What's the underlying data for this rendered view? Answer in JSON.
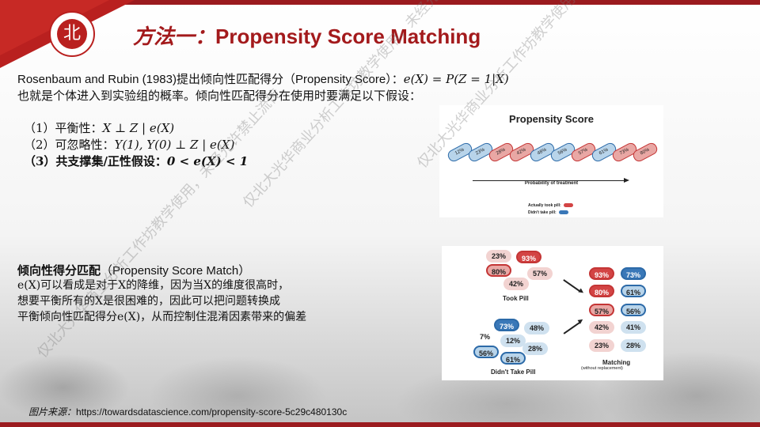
{
  "title": {
    "cn": "方法一：",
    "en": "Propensity Score Matching"
  },
  "logo": {
    "glyph": "北",
    "icon": "pku-logo-icon"
  },
  "intro": {
    "line1_a": "Rosenbaum and Rubin (1983)",
    "line1_b": "提出倾向性匹配得分（",
    "line1_c": "Propensity Score",
    "line1_d": "）：",
    "line1_e": "e(X) = P(Z = 1|X)",
    "line2": "也就是个体进入到实验组的概率。倾向性匹配得分在使用时要满足以下假设："
  },
  "assumptions": [
    {
      "label": "（1）平衡性：",
      "formula": "X ⊥ Z | e(X)"
    },
    {
      "label": "（2）可忽略性：",
      "formula": "Y(1), Y(0)  ⊥ Z | e(X)"
    },
    {
      "label": "（3）共支撑集/正性假设：",
      "formula": "0 < e(X) < 1"
    }
  ],
  "ps_figure": {
    "title": "Propensity Score",
    "pills": [
      {
        "value": "12%",
        "group": "blue"
      },
      {
        "value": "23%",
        "group": "blue"
      },
      {
        "value": "28%",
        "group": "red"
      },
      {
        "value": "42%",
        "group": "red"
      },
      {
        "value": "48%",
        "group": "blue"
      },
      {
        "value": "56%",
        "group": "blue"
      },
      {
        "value": "57%",
        "group": "red"
      },
      {
        "value": "61%",
        "group": "blue"
      },
      {
        "value": "73%",
        "group": "red"
      },
      {
        "value": "80%",
        "group": "red"
      }
    ],
    "axis": "Probability of treatment",
    "legend_took": "Actually took pill:",
    "legend_didnt": "Didn't take pill:"
  },
  "matching_text": {
    "title_cn": "倾向性得分匹配",
    "title_en": "（Propensity Score Match）",
    "line1": "e(X)可以看成是对于X的降维，因为当X的维度很高时，",
    "line2": "想要平衡所有的X是很困难的，因此可以把问题转换成",
    "line3": "平衡倾向性匹配得分e(X)，从而控制住混淆因素带来的偏差"
  },
  "matching_figure": {
    "took": [
      "23%",
      "93%",
      "80%",
      "57%",
      "42%"
    ],
    "took_label": "Took Pill",
    "didnt": [
      "73%",
      "48%",
      "7%",
      "12%",
      "28%",
      "56%",
      "61%"
    ],
    "didnt_label": "Didn't Take Pill",
    "pairs": [
      [
        "93%",
        "73%"
      ],
      [
        "80%",
        "61%"
      ],
      [
        "57%",
        "56%"
      ],
      [
        "42%",
        "41%"
      ],
      [
        "23%",
        "28%"
      ]
    ],
    "matching_label": "Matching",
    "matching_sub": "(without replacement)"
  },
  "source": {
    "label": "图片来源：",
    "url": "https://towardsdatascience.com/propensity-score-5c29c480130c"
  },
  "watermark": "仅北大光华商业分析工作坊教学使用，未经允许禁止流传",
  "colors": {
    "accent": "#a31a1c",
    "red_pill": "#c43535",
    "blue_pill": "#2c6aa8"
  }
}
